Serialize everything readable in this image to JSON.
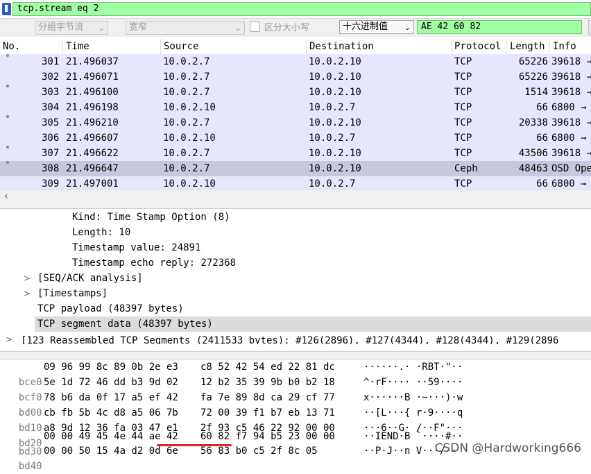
{
  "filter": {
    "value": "tcp.stream eq 2"
  },
  "find_bar": {
    "search_in": "分组字节流",
    "char_width": "宽窄",
    "case_label": "区分大小写",
    "search_type": "十六进制值",
    "search_value": "AE 42 60 82"
  },
  "packet_list": {
    "columns": [
      "No.",
      "Time",
      "Source",
      "Destination",
      "Protocol",
      "Length",
      "Info"
    ],
    "rows": [
      {
        "no": "301",
        "time": "21.496037",
        "src": "10.0.2.7",
        "dst": "10.0.2.10",
        "proto": "TCP",
        "len": "65226",
        "info": "39618 →"
      },
      {
        "no": "302",
        "time": "21.496071",
        "src": "10.0.2.7",
        "dst": "10.0.2.10",
        "proto": "TCP",
        "len": "65226",
        "info": "39618 →"
      },
      {
        "no": "303",
        "time": "21.496100",
        "src": "10.0.2.7",
        "dst": "10.0.2.10",
        "proto": "TCP",
        "len": "1514",
        "info": "39618 →"
      },
      {
        "no": "304",
        "time": "21.496198",
        "src": "10.0.2.10",
        "dst": "10.0.2.7",
        "proto": "TCP",
        "len": "66",
        "info": "6800 →"
      },
      {
        "no": "305",
        "time": "21.496210",
        "src": "10.0.2.7",
        "dst": "10.0.2.10",
        "proto": "TCP",
        "len": "20338",
        "info": "39618 →"
      },
      {
        "no": "306",
        "time": "21.496607",
        "src": "10.0.2.10",
        "dst": "10.0.2.7",
        "proto": "TCP",
        "len": "66",
        "info": "6800 →"
      },
      {
        "no": "307",
        "time": "21.496622",
        "src": "10.0.2.7",
        "dst": "10.0.2.10",
        "proto": "TCP",
        "len": "43506",
        "info": "39618 →"
      },
      {
        "no": "308",
        "time": "21.496647",
        "src": "10.0.2.7",
        "dst": "10.0.2.10",
        "proto": "Ceph",
        "len": "48463",
        "info": "OSD Ope"
      },
      {
        "no": "309",
        "time": "21.497001",
        "src": "10.0.2.10",
        "dst": "10.0.2.7",
        "proto": "TCP",
        "len": "66",
        "info": "6800 →"
      }
    ]
  },
  "details": {
    "kind": "Kind: Time Stamp Option (8)",
    "length": "Length: 10",
    "ts_value": "Timestamp value: 24891",
    "ts_echo": "Timestamp echo reply: 272368",
    "seq_ack": "[SEQ/ACK analysis]",
    "timestamps": "[Timestamps]",
    "payload": "TCP payload (48397 bytes)",
    "segment_data": "TCP segment data (48397 bytes)",
    "reassembled": "[123 Reassembled TCP Segments (2411533 bytes): #126(2896), #127(4344), #128(4344), #129(2896"
  },
  "bytes": [
    {
      "off": "bce0",
      "a": "09 96 99 8c 89 0b 2e e3",
      "b": "c8 52 42 54 ed 22 81 dc",
      "ascii": "······.· ·RBT·\"··"
    },
    {
      "off": "bcf0",
      "a": "5e 1d 72 46 dd b3 9d 02",
      "b": "12 b2 35 39 9b b0 b2 18",
      "ascii": "^·rF···· ··59····"
    },
    {
      "off": "bd00",
      "a": "78 b6 da 0f 17 a5 ef 42",
      "b": "fa 7e 89 8d ca 29 cf 77",
      "ascii": "x······B ·~···)·w"
    },
    {
      "off": "bd10",
      "a": "cb fb 5b 4c d8 a5 06 7b",
      "b": "72 00 39 f1 b7 eb 13 71",
      "ascii": "··[L···{ r·9····q"
    },
    {
      "off": "bd20",
      "a": "a8 9d 12 36 fa 03 47 e1",
      "b": "2f 93 c5 46 22 92 00 00",
      "ascii": "···6··G· /··F\"···"
    },
    {
      "off": "bd30",
      "a": "00 00 49 45 4e 44 ae 42",
      "b": "60 82 f7 94 b5 23 00 00",
      "ascii": "··IEND·B `····#··"
    },
    {
      "off": "bd40",
      "a": "00 00 50 15 4a d2 0d 6e",
      "b": "56 83 b0 c5 2f 8c 05",
      "ascii": "··P·J··n V···/··"
    }
  ],
  "watermark": "CSDN @Hardworking666",
  "colors": {
    "filter_ok": "#a0ffa0",
    "row_bg": "#e7e6ff",
    "row_selected": "#c8c7e0",
    "annotation": "#e8202a"
  }
}
